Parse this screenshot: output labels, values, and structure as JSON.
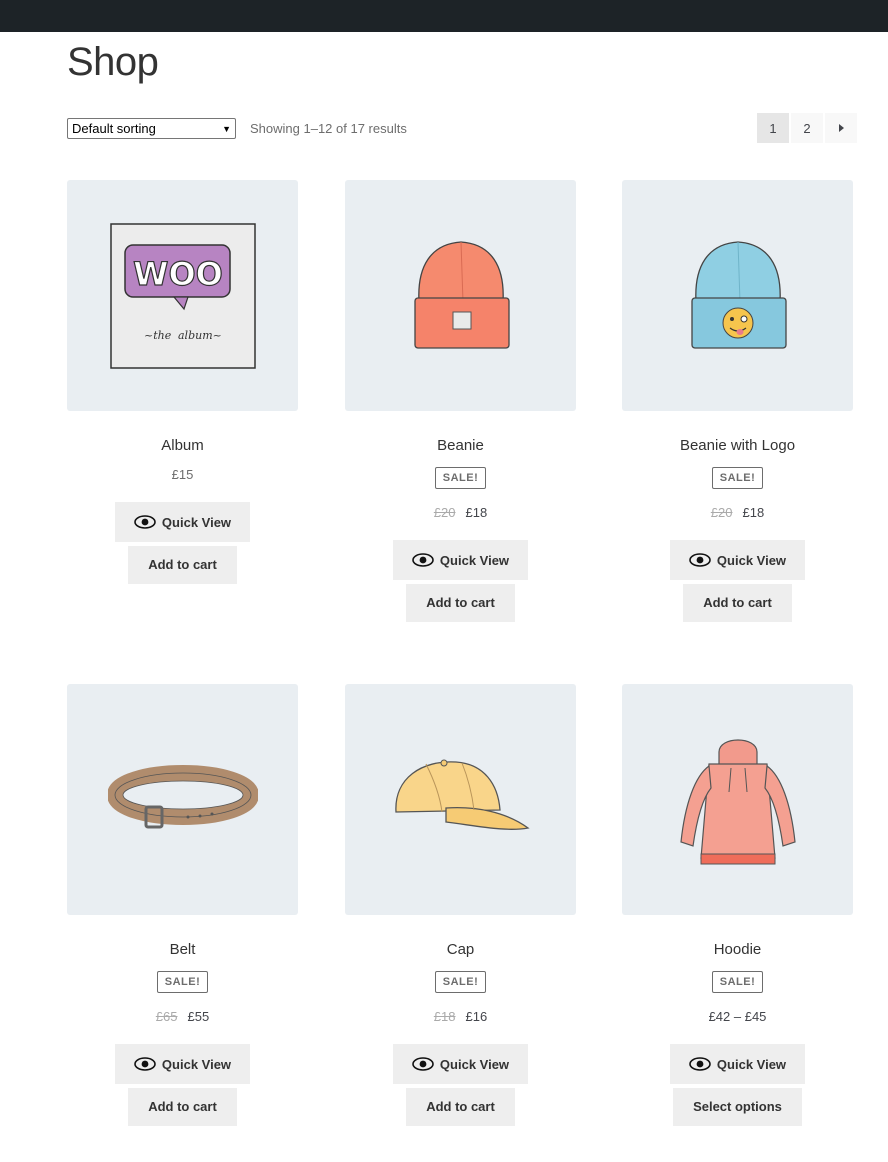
{
  "page": {
    "title": "Shop"
  },
  "toolbar": {
    "sorting_value": "Default sorting",
    "results_text": "Showing 1–12 of 17 results"
  },
  "pagination": {
    "pages": [
      "1",
      "2"
    ],
    "current": "1"
  },
  "products": [
    {
      "name": "Album",
      "on_sale": false,
      "price": "£15",
      "quick_view_label": "Quick View",
      "cart_label": "Add to cart",
      "image": "woo-album"
    },
    {
      "name": "Beanie",
      "on_sale": true,
      "sale_label": "SALE!",
      "old_price": "£20",
      "price": "£18",
      "quick_view_label": "Quick View",
      "cart_label": "Add to cart",
      "image": "orange-beanie"
    },
    {
      "name": "Beanie with Logo",
      "on_sale": true,
      "sale_label": "SALE!",
      "old_price": "£20",
      "price": "£18",
      "quick_view_label": "Quick View",
      "cart_label": "Add to cart",
      "image": "blue-beanie-emoji"
    },
    {
      "name": "Belt",
      "on_sale": true,
      "sale_label": "SALE!",
      "old_price": "£65",
      "price": "£55",
      "quick_view_label": "Quick View",
      "cart_label": "Add to cart",
      "image": "leather-belt"
    },
    {
      "name": "Cap",
      "on_sale": true,
      "sale_label": "SALE!",
      "old_price": "£18",
      "price": "£16",
      "quick_view_label": "Quick View",
      "cart_label": "Add to cart",
      "image": "yellow-cap"
    },
    {
      "name": "Hoodie",
      "on_sale": true,
      "sale_label": "SALE!",
      "old_price": "",
      "price": "£42 – £45",
      "quick_view_label": "Quick View",
      "cart_label": "Select options",
      "image": "pink-hoodie"
    }
  ],
  "colors": {
    "topbar": "#1d2327",
    "thumb_bg": "#e9eef2",
    "button_bg": "#eeeeee"
  }
}
